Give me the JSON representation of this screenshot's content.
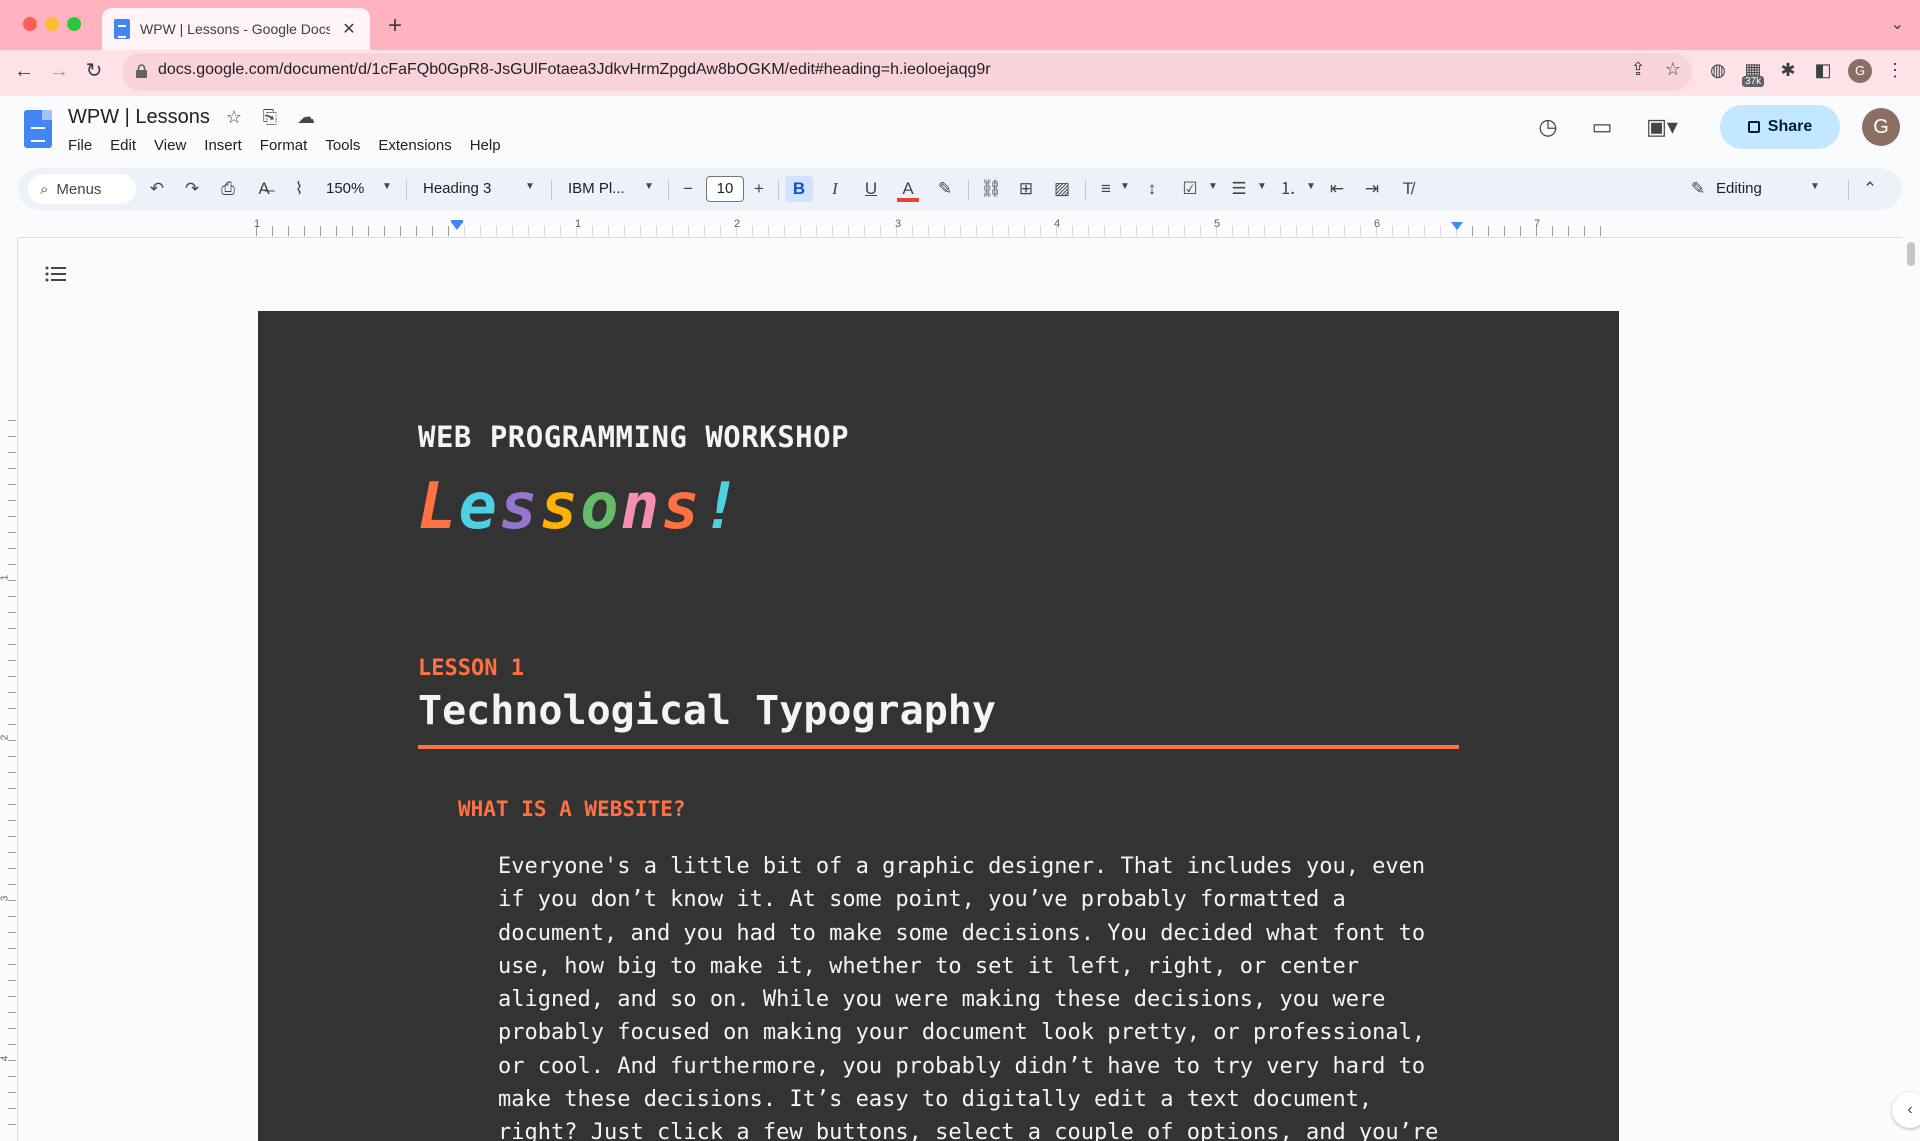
{
  "browser": {
    "tab_title": "WPW | Lessons - Google Docs",
    "url": "docs.google.com/document/d/1cFaFQb0GpR8-JsGUlFotaea3JdkvHrmZpgdAw8bOGKM/edit#heading=h.ieoloejaqg9r",
    "extension_badge": "37k",
    "profile_initial": "G"
  },
  "docs": {
    "title": "WPW | Lessons",
    "menu": [
      "File",
      "Edit",
      "View",
      "Insert",
      "Format",
      "Tools",
      "Extensions",
      "Help"
    ],
    "share_label": "Share",
    "account_initial": "G"
  },
  "toolbar": {
    "menus_search": "Menus",
    "zoom": "150%",
    "style": "Heading 3",
    "font": "IBM Pl...",
    "font_size": "10",
    "mode": "Editing",
    "text_color": "#ea4335"
  },
  "ruler": {
    "numbers": [
      "1",
      "1",
      "2",
      "3",
      "4",
      "5",
      "6",
      "7"
    ],
    "vertical_numbers": [
      "1",
      "2",
      "3",
      "4"
    ]
  },
  "document": {
    "kicker": "WEB PROGRAMMING WORKSHOP",
    "big_title_letters": [
      "L",
      "e",
      "s",
      "s",
      "o",
      "n",
      "s",
      "!"
    ],
    "lesson_label": "LESSON 1",
    "lesson_title": "Technological Typography",
    "section_heading": "WHAT IS A WEBSITE?",
    "body_lines": [
      "Everyone's a little bit of a graphic designer. That includes you, even",
      "if you don’t know it. At some point, you’ve probably formatted a",
      "document, and you had to make some decisions. You decided what font to",
      "use, how big to make it, whether to set it left, right, or center",
      "aligned, and so on. While you were making these decisions, you were",
      "probably focused on making your document look pretty, or professional,",
      "or cool. And furthermore, you probably didn’t have to try very hard to",
      "make these decisions. It’s easy to digitally edit a text document,",
      "right? Just click a few buttons, select a couple of options, and you’re"
    ],
    "page_color": "#333333",
    "accent_color": "#ff7043"
  }
}
